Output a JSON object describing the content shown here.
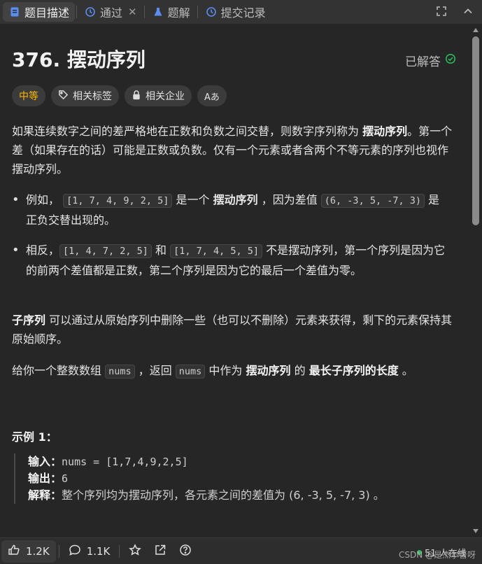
{
  "tabs": [
    {
      "label": "题目描述",
      "icon": "doc-icon"
    },
    {
      "label": "通过",
      "icon": "history-icon"
    },
    {
      "label": "题解",
      "icon": "flask-icon"
    },
    {
      "label": "提交记录",
      "icon": "history-icon"
    }
  ],
  "problem": {
    "title": "376. 摆动序列",
    "status": "已解答",
    "tags": {
      "difficulty": "中等",
      "related_tags": "相关标签",
      "related_companies": "相关企业",
      "translate": "Aあ"
    }
  },
  "desc": {
    "p1_a": "如果连续数字之间的差严格地在正数和负数之间交替，则数字序列称为 ",
    "p1_b": "摆动序列",
    "p1_c": "。第一个差（如果存在的话）可能是正数或负数。仅有一个元素或者含两个不等元素的序列也视作摆动序列。",
    "b1_a": "例如， ",
    "b1_code1": "[1, 7, 4, 9, 2, 5]",
    "b1_b": " 是一个 ",
    "b1_bold": "摆动序列",
    "b1_c": " ，因为差值 ",
    "b1_code2": "(6, -3, 5, -7, 3)",
    "b1_d": " 是正负交替出现的。",
    "b2_a": "相反，",
    "b2_code1": "[1, 4, 7, 2, 5]",
    "b2_b": " 和 ",
    "b2_code2": "[1, 7, 4, 5, 5]",
    "b2_c": " 不是摆动序列，第一个序列是因为它的前两个差值都是正数，第二个序列是因为它的最后一个差值为零。",
    "p2_bold": "子序列",
    "p2_a": " 可以通过从原始序列中删除一些（也可以不删除）元素来获得，剩下的元素保持其原始顺序。",
    "p3_a": "给你一个整数数组 ",
    "p3_code1": "nums",
    "p3_b": " ，返回 ",
    "p3_code2": "nums",
    "p3_c": " 中作为 ",
    "p3_bold1": "摆动序列",
    "p3_d": " 的 ",
    "p3_bold2": "最长子序列的长度",
    "p3_e": " 。"
  },
  "example": {
    "title": "示例 1：",
    "input_label": "输入：",
    "input_value": "nums = [1,7,4,9,2,5]",
    "output_label": "输出：",
    "output_value": "6",
    "explain_label": "解释：",
    "explain_value": "整个序列均为摆动序列，各元素之间的差值为 (6, -3, 5, -7, 3) 。"
  },
  "bottom": {
    "likes": "1.2K",
    "comments": "1.1K",
    "online": "51 人在线",
    "watermark": "CSDN @是杰尔普呀"
  },
  "colors": {
    "difficulty": "#ffb800",
    "solved_check": "#2cbb5d",
    "online_dot": "#2cbb5d"
  }
}
